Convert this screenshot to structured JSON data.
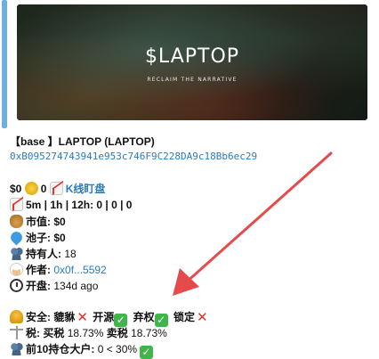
{
  "banner": {
    "title": "$LAPTOP",
    "subtitle": "RECLAIM THE NARRATIVE"
  },
  "token": {
    "header": "【base 】LAPTOP (LAPTOP)",
    "address": "0xB095274743941e953c746F9C228DA9c18Bb6ec29"
  },
  "price_row": {
    "price": "$0",
    "coin_value": "0",
    "chart_link": "K线盯盘"
  },
  "timeframes": "5m | 1h | 12h: 0 | 0 | 0",
  "market_cap": {
    "label": "市值:",
    "value": "$0"
  },
  "pool": {
    "label": "池子:",
    "value": "$0"
  },
  "holders": {
    "label": "持有人:",
    "value": "18"
  },
  "author": {
    "label": "作者:",
    "value": "0x0f...5592"
  },
  "opened": {
    "label": "开盘:",
    "value": "134d ago"
  },
  "security": {
    "label": "安全:",
    "honeypot": "貔貅",
    "open_source": "开源",
    "renounced": "弃权",
    "locked": "锁定"
  },
  "tax": {
    "label": "税:",
    "buy_label": "买税",
    "buy": "18.73%",
    "sell_label": "卖税",
    "sell": "18.73%"
  },
  "top10": {
    "label": "前10持仓大户:",
    "value": "0 < 30%"
  },
  "colors": {
    "accent": "#6bb0de",
    "link": "#2a7bbf",
    "arrow": "#e64b4b",
    "check": "#3fb54a",
    "cross": "#e0322b"
  }
}
